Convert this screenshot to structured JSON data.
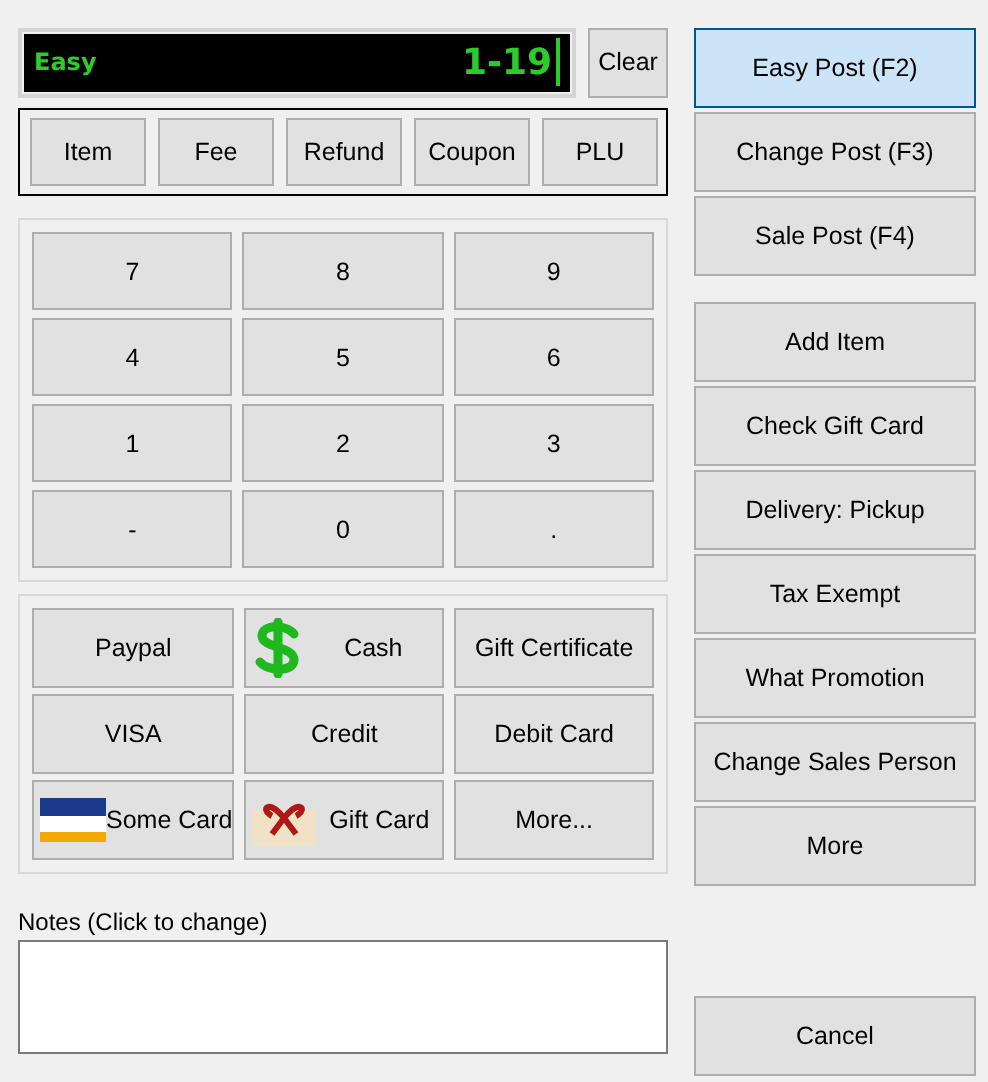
{
  "display": {
    "mode": "Easy",
    "value": "1-19"
  },
  "clear_button": "Clear",
  "entry_types": [
    "Item",
    "Fee",
    "Refund",
    "Coupon",
    "PLU"
  ],
  "keypad": [
    "7",
    "8",
    "9",
    "4",
    "5",
    "6",
    "1",
    "2",
    "3",
    "-",
    "0",
    "."
  ],
  "payments": [
    {
      "label": "Paypal",
      "kind": "plain"
    },
    {
      "label": "Cash",
      "kind": "cash"
    },
    {
      "label": "Gift Certificate",
      "kind": "plain"
    },
    {
      "label": "VISA",
      "kind": "plain"
    },
    {
      "label": "Credit",
      "kind": "plain"
    },
    {
      "label": "Debit Card",
      "kind": "plain"
    },
    {
      "label": "Some Card",
      "kind": "card"
    },
    {
      "label": "Gift Card",
      "kind": "gift"
    },
    {
      "label": "More...",
      "kind": "plain"
    }
  ],
  "notes": {
    "label": "Notes (Click to change)"
  },
  "post_modes": [
    {
      "label": "Easy Post (F2)",
      "selected": true
    },
    {
      "label": "Change Post (F3)",
      "selected": false
    },
    {
      "label": "Sale Post (F4)",
      "selected": false
    }
  ],
  "actions": [
    "Add Item",
    "Check Gift Card",
    "Delivery: Pickup",
    "Tax Exempt",
    "What Promotion",
    "Change Sales Person",
    "More"
  ],
  "cancel_button": "Cancel"
}
